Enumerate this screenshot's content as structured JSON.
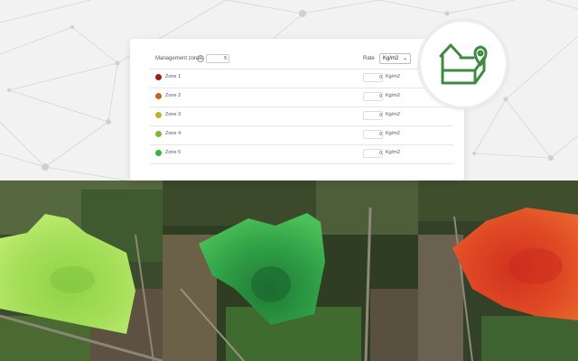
{
  "panel": {
    "title": "Management zones",
    "info_glyph": "i",
    "zone_count": "5",
    "rate_label": "Rate",
    "unit_select": "Kg/m2",
    "zones": [
      {
        "name": "Zone 1",
        "color": "#a01e14",
        "value": "0",
        "unit": "Kg/m2"
      },
      {
        "name": "Zone 2",
        "color": "#c4631c",
        "value": "0",
        "unit": "Kg/m2"
      },
      {
        "name": "Zone 3",
        "color": "#b7b328",
        "value": "0",
        "unit": "Kg/m2"
      },
      {
        "name": "Zone 4",
        "color": "#7db92f",
        "value": "0",
        "unit": "Kg/m2"
      },
      {
        "name": "Zone 5",
        "color": "#35b437",
        "value": "0",
        "unit": "Kg/m2"
      }
    ]
  },
  "badge": {
    "icon": "farm-location-icon",
    "color": "#3f8a42"
  },
  "maps": [
    {
      "palette": "light-green"
    },
    {
      "palette": "dark-green"
    },
    {
      "palette": "red"
    }
  ]
}
